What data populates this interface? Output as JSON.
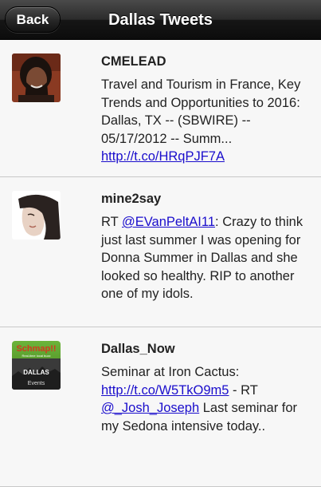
{
  "navbar": {
    "back_label": "Back",
    "title": "Dallas Tweets"
  },
  "tweets": [
    {
      "user": "CMELEAD",
      "text": "Travel and Tourism in France, Key Trends and Opportunities to 2016: Dallas, TX -- (SBWIRE) -- 05/17/2012 -- Summ...",
      "link": "http://t.co/HRqPJF7A"
    },
    {
      "user": "mine2say",
      "prefix": "RT ",
      "mention": "@EVanPeltAI11",
      "text": ": Crazy to think just last summer I was opening for Donna Summer in Dallas and she looked so healthy. RIP to another one of my idols."
    },
    {
      "user": "Dallas_Now",
      "text_start": "Seminar at Iron Cactus: ",
      "link": "http://t.co/W5TkO9m5",
      "text_middle": " - RT ",
      "mention": "@_Josh_Joseph",
      "text_end": " Last seminar for my Sedona intensive today..",
      "avatar_brand": "Schmap!!",
      "avatar_tagline": "Real-time local buzz",
      "avatar_city": "DALLAS",
      "avatar_label": "Events"
    }
  ],
  "colors": {
    "link": "#1a0dcc",
    "schmap_green": "#5aa02c",
    "schmap_red": "#d23a1e"
  }
}
